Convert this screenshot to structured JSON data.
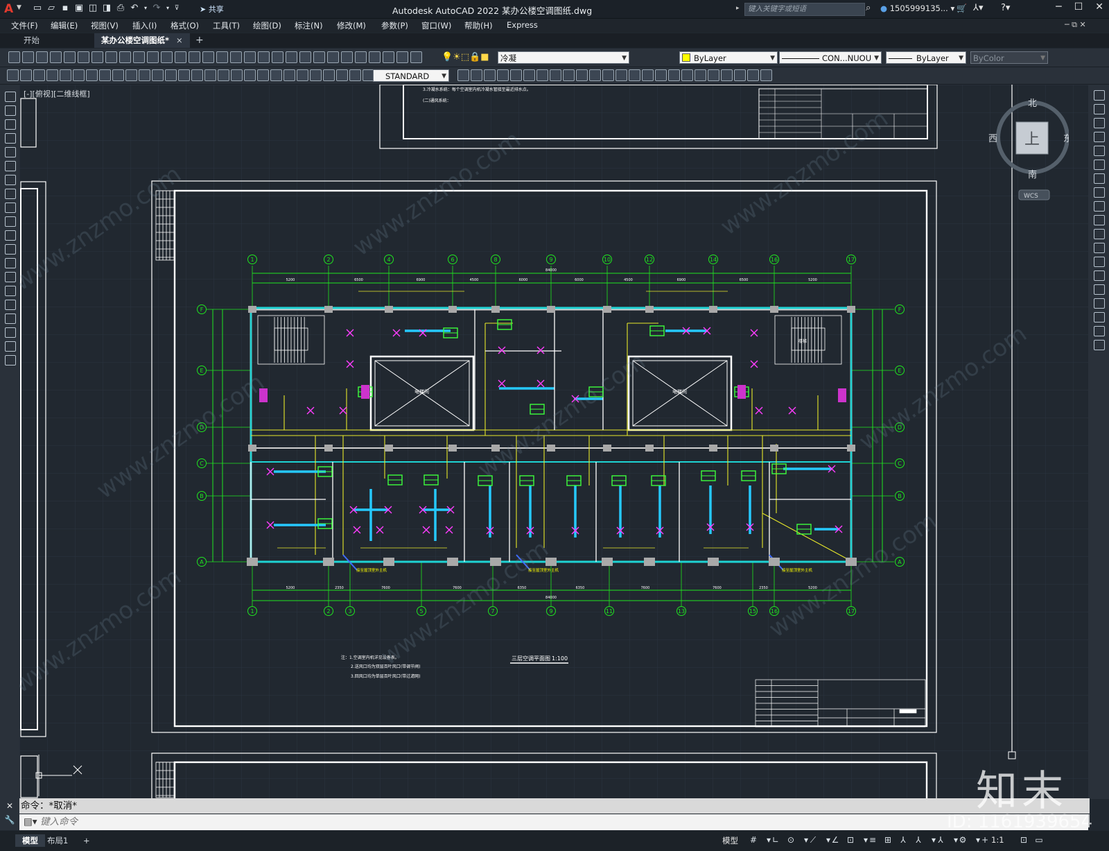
{
  "app": {
    "title": "Autodesk AutoCAD 2022    某办公楼空调图纸.dwg",
    "share_label": "共享",
    "search_placeholder": "键入关键字或短语",
    "user": "1505999135...",
    "accent_color": "#e23a2e"
  },
  "menu": [
    "文件(F)",
    "编辑(E)",
    "视图(V)",
    "插入(I)",
    "格式(O)",
    "工具(T)",
    "绘图(D)",
    "标注(N)",
    "修改(M)",
    "参数(P)",
    "窗口(W)",
    "帮助(H)",
    "Express"
  ],
  "tabs": {
    "start": "开始",
    "active": "某办公楼空调图纸*",
    "close": "×",
    "add": "+"
  },
  "properties": {
    "layer": "冷凝",
    "color": "ByLayer",
    "linetype": "CON...NUOU",
    "lineweight": "ByLayer",
    "plotstyle": "ByColor",
    "textstyle": "STANDARD"
  },
  "viewport": {
    "label": "[-][俯视][二维线框]",
    "viewcube": {
      "north": "北",
      "south": "南",
      "west": "西",
      "east": "东",
      "face": "上",
      "ucs": "WCS"
    }
  },
  "drawing": {
    "plan_title": "三层空调平面图",
    "scale": "1:100",
    "grid_top": [
      "1",
      "2",
      "4",
      "6",
      "8",
      "9",
      "10",
      "12",
      "14",
      "16",
      "17"
    ],
    "grid_bottom": [
      "1",
      "2",
      "3",
      "5",
      "7",
      "9",
      "11",
      "13",
      "15",
      "16",
      "17"
    ],
    "grid_rows": [
      "F",
      "E",
      "D",
      "C",
      "B",
      "A"
    ],
    "dims_top": [
      "5200",
      "6500",
      "6900",
      "4500",
      "6000",
      "6000",
      "4500",
      "6900",
      "6500",
      "5200"
    ],
    "dims_bottom": [
      "5200",
      "2350",
      "7600",
      "7600",
      "6350",
      "6350",
      "7600",
      "7600",
      "2350",
      "5200"
    ],
    "total_dim": "84000",
    "room_labels": [
      "电梯间",
      "电梯间",
      "楼梯"
    ],
    "notes": [
      "注：1.空调室内机详见设备表。",
      "2.送风口均为双层百叶风口(带调节阀)",
      "3.回风口均为单层百叶风口(带过滤网)"
    ],
    "outdoor_label": "接至屋顶室外主机",
    "top_notes": [
      "3.冷凝水系统：每个空调室内机冷凝水管接至最近排水点。",
      "(二)通风系统："
    ]
  },
  "command": {
    "history": "命令：*取消*",
    "placeholder": "键入命令"
  },
  "status": {
    "tab_model": "模型",
    "tab_layout": "布局1",
    "add": "+",
    "model_label": "模型",
    "scale": "1:1"
  },
  "watermark": {
    "logo": "知末",
    "id": "ID: 1161939654",
    "url": "www.znzmo.com"
  }
}
